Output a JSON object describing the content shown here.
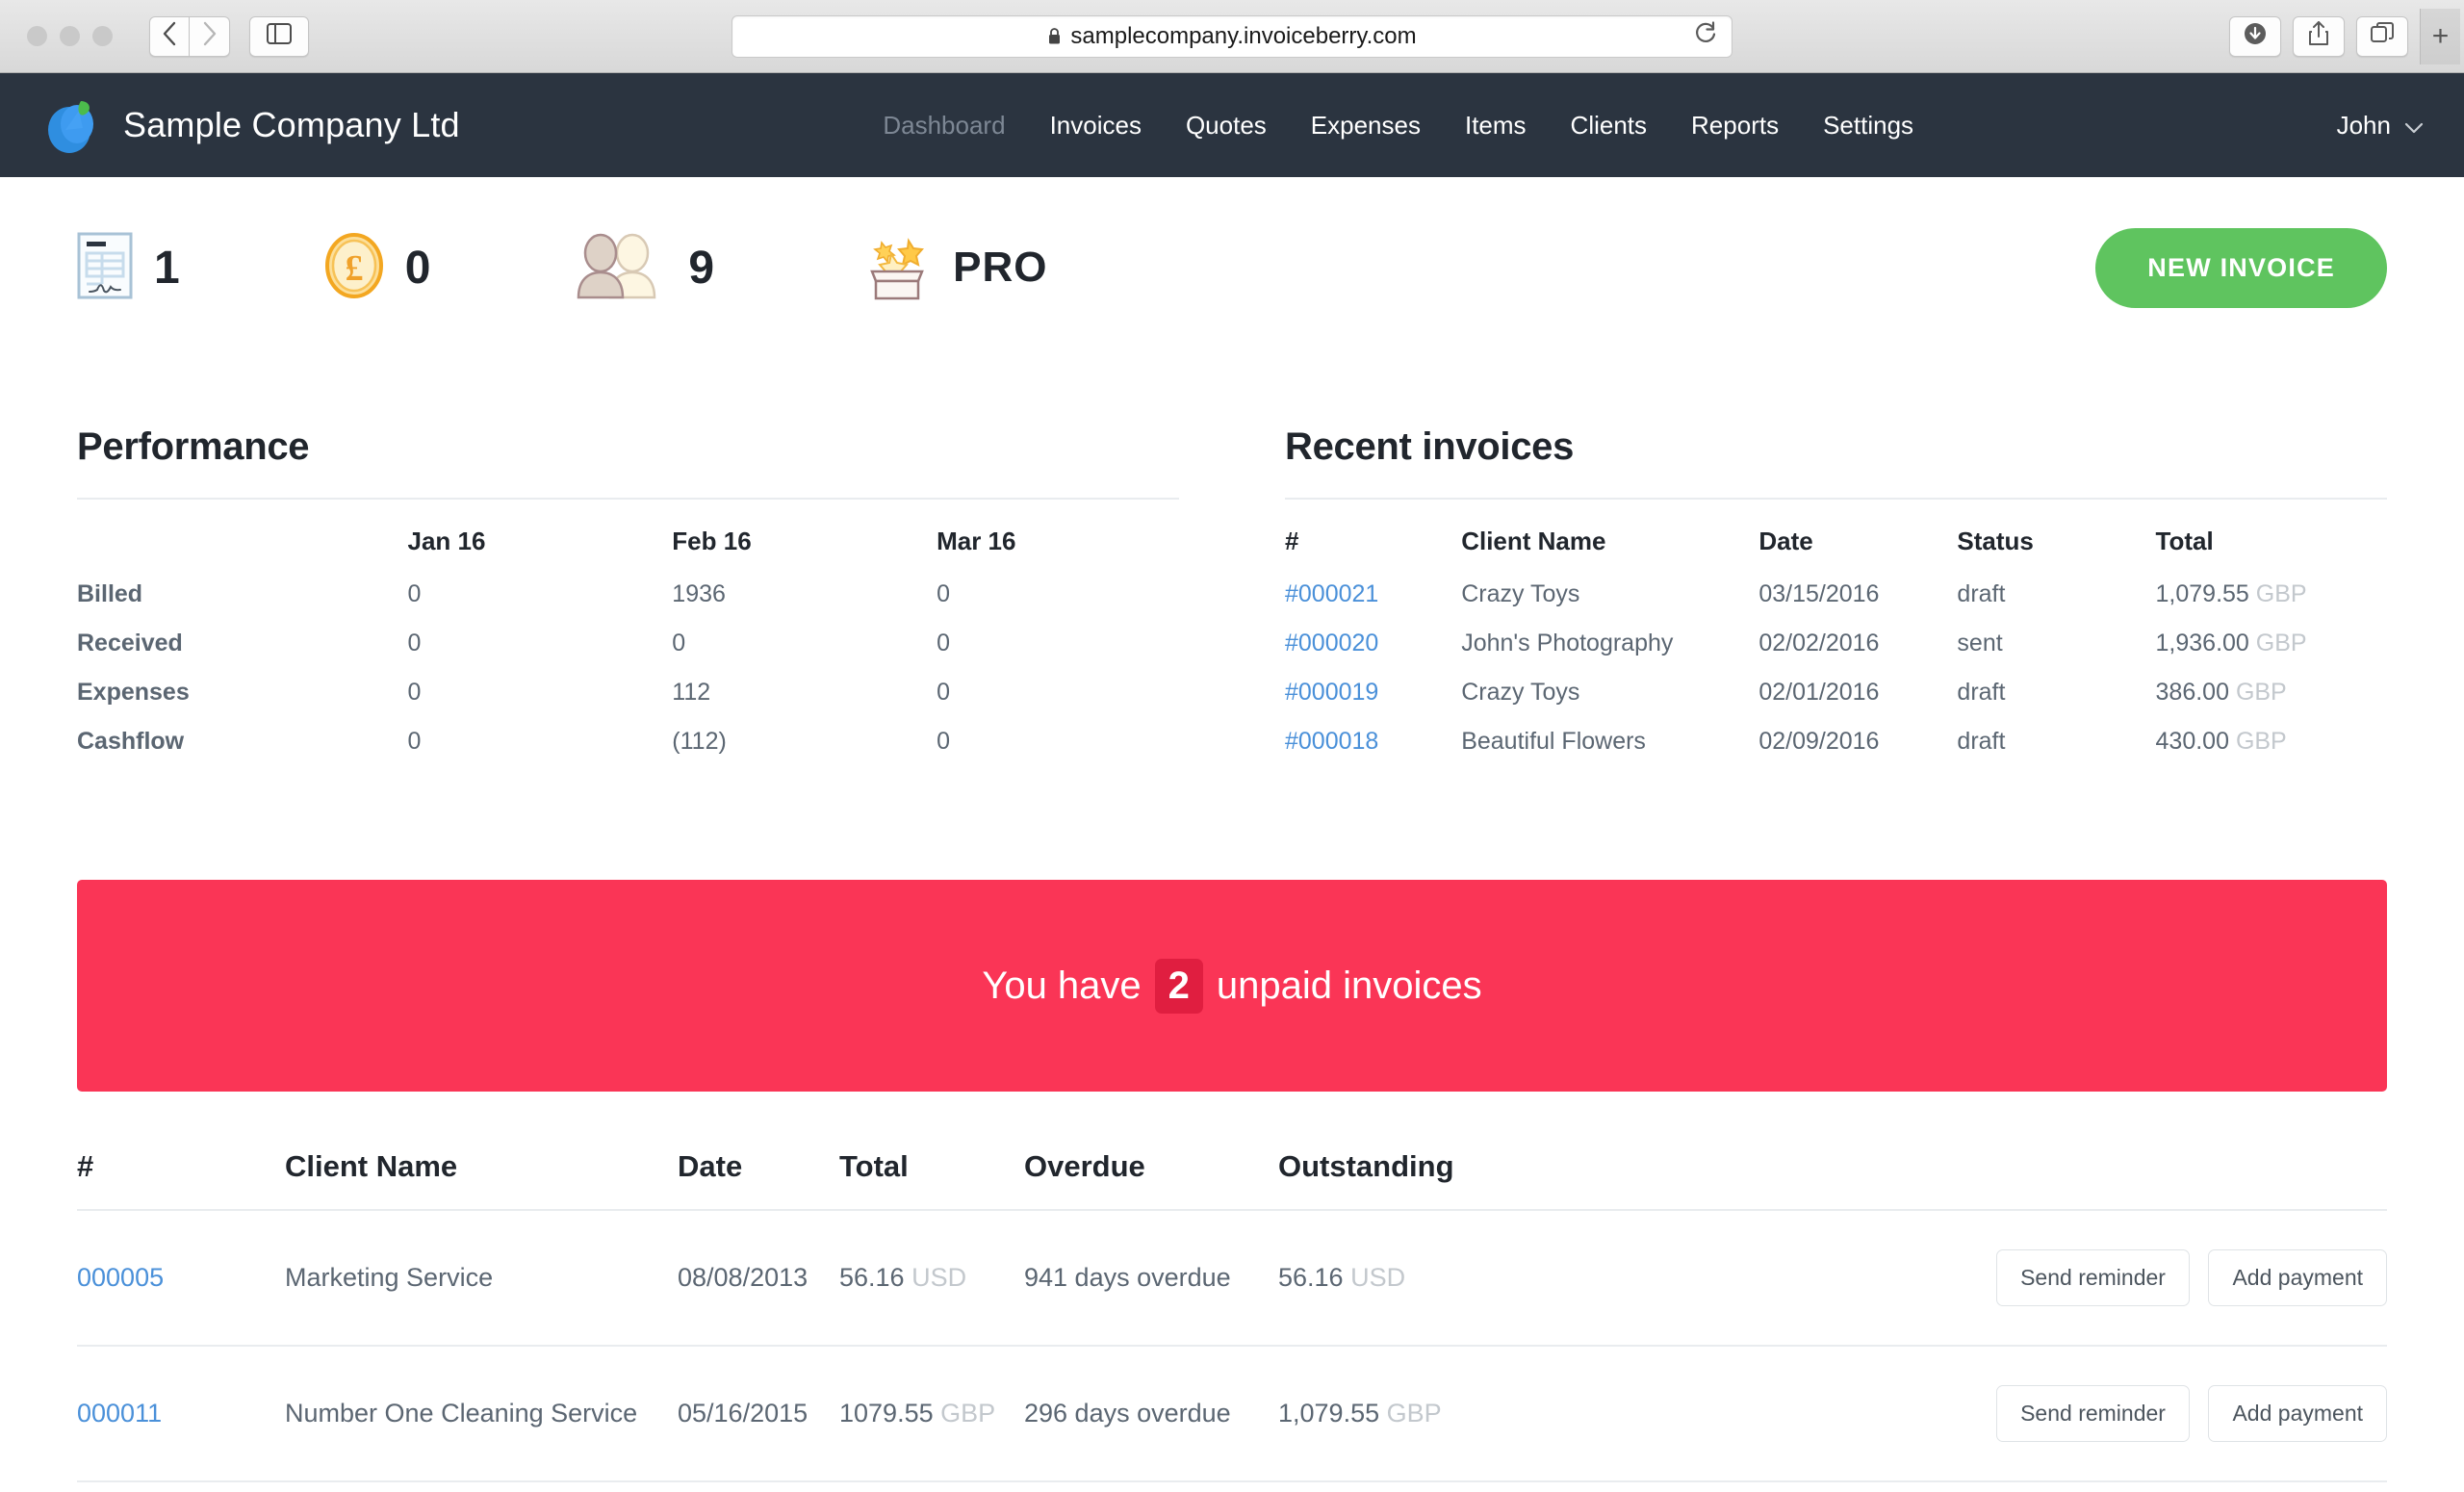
{
  "browser": {
    "url": "samplecompany.invoiceberry.com",
    "lock_icon": "lock-icon",
    "back_icon": "back-arrow-icon",
    "forward_icon": "forward-arrow-icon",
    "sidebar_icon": "sidebar-toggle-icon",
    "reload_icon": "reload-icon",
    "downloads_icon": "downloads-icon",
    "share_icon": "share-icon",
    "tabs_icon": "show-tabs-icon",
    "new_tab_label": "+"
  },
  "navbar": {
    "brand": "Sample Company Ltd",
    "links": [
      {
        "label": "Dashboard",
        "active": true
      },
      {
        "label": "Invoices",
        "active": false
      },
      {
        "label": "Quotes",
        "active": false
      },
      {
        "label": "Expenses",
        "active": false
      },
      {
        "label": "Items",
        "active": false
      },
      {
        "label": "Clients",
        "active": false
      },
      {
        "label": "Reports",
        "active": false
      },
      {
        "label": "Settings",
        "active": false
      }
    ],
    "user": "John"
  },
  "stats": {
    "invoices": "1",
    "revenue": "0",
    "clients": "9",
    "plan": "PRO",
    "new_invoice_label": "NEW INVOICE"
  },
  "performance": {
    "title": "Performance",
    "columns": [
      "",
      "Jan 16",
      "Feb 16",
      "Mar 16"
    ],
    "rows": [
      {
        "label": "Billed",
        "values": [
          "0",
          "1936",
          "0"
        ]
      },
      {
        "label": "Received",
        "values": [
          "0",
          "0",
          "0"
        ]
      },
      {
        "label": "Expenses",
        "values": [
          "0",
          "112",
          "0"
        ]
      },
      {
        "label": "Cashflow",
        "values": [
          "0",
          "(112)",
          "0"
        ],
        "signs": [
          "pos",
          "neg",
          "pos"
        ]
      }
    ]
  },
  "recent_invoices": {
    "title": "Recent invoices",
    "columns": [
      "#",
      "Client Name",
      "Date",
      "Status",
      "Total"
    ],
    "rows": [
      {
        "number": "#000021",
        "client": "Crazy Toys",
        "date": "03/15/2016",
        "status": "draft",
        "amount": "1,079.55",
        "currency": "GBP"
      },
      {
        "number": "#000020",
        "client": "John's Photography",
        "date": "02/02/2016",
        "status": "sent",
        "amount": "1,936.00",
        "currency": "GBP"
      },
      {
        "number": "#000019",
        "client": "Crazy Toys",
        "date": "02/01/2016",
        "status": "draft",
        "amount": "386.00",
        "currency": "GBP"
      },
      {
        "number": "#000018",
        "client": "Beautiful Flowers",
        "date": "02/09/2016",
        "status": "draft",
        "amount": "430.00",
        "currency": "GBP"
      }
    ]
  },
  "banner": {
    "prefix": "You have",
    "count": "2",
    "suffix": "unpaid invoices",
    "color": "#fa3556",
    "badge_color": "#e01e40"
  },
  "unpaid": {
    "columns": [
      "#",
      "Client Name",
      "Date",
      "Total",
      "Overdue",
      "Outstanding",
      ""
    ],
    "rows": [
      {
        "number": "000005",
        "client": "Marketing Service",
        "date": "08/08/2013",
        "total": "56.16",
        "total_currency": "USD",
        "overdue": "941 days overdue",
        "outstanding": "56.16",
        "outstanding_currency": "USD",
        "reminder_label": "Send reminder",
        "payment_label": "Add payment"
      },
      {
        "number": "000011",
        "client": "Number One Cleaning Service",
        "date": "05/16/2015",
        "total": "1079.55",
        "total_currency": "GBP",
        "overdue": "296 days overdue",
        "outstanding": "1,079.55",
        "outstanding_currency": "GBP",
        "reminder_label": "Send reminder",
        "payment_label": "Add payment"
      }
    ]
  }
}
